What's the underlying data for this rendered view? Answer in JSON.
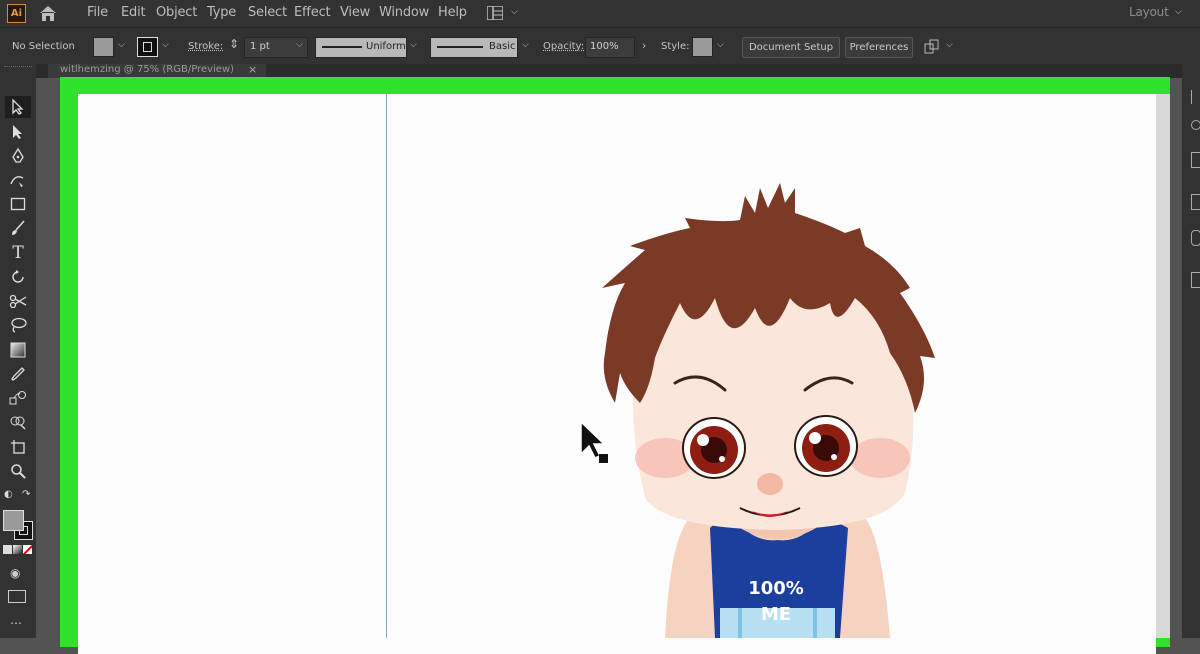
{
  "app": {
    "logo_text": "Ai",
    "layout_label": "Layout"
  },
  "menu": [
    "File",
    "Edit",
    "Object",
    "Type",
    "Select",
    "Effect",
    "View",
    "Window",
    "Help"
  ],
  "control_bar": {
    "selection_label": "No Selection",
    "stroke_label": "Stroke:",
    "stroke_weight": "1 pt",
    "profile_label": "Uniform",
    "brush_label": "Basic",
    "opacity_label": "Opacity:",
    "opacity_value": "100%",
    "style_label": "Style:",
    "document_setup_label": "Document Setup",
    "preferences_label": "Preferences"
  },
  "document_tab": {
    "title": "witlhemzing @ 75% (RGB/Preview)"
  },
  "artwork": {
    "shirt_text_line1": "100%",
    "shirt_text_line2": "ME"
  },
  "colors": {
    "canvas_highlight": "#2fe32c",
    "guide": "#79a6b8",
    "hair": "#7a3a26",
    "shirt": "#1c3f9e"
  },
  "tools": [
    "selection-tool",
    "direct-selection-tool",
    "pen-tool",
    "curvature-tool",
    "rectangle-tool",
    "paintbrush-tool",
    "type-tool",
    "rotate-tool",
    "scissors-tool",
    "lasso-tool",
    "gradient-tool",
    "eyedropper-tool",
    "blend-tool",
    "shape-builder-tool",
    "artboard-tool",
    "zoom-tool"
  ]
}
